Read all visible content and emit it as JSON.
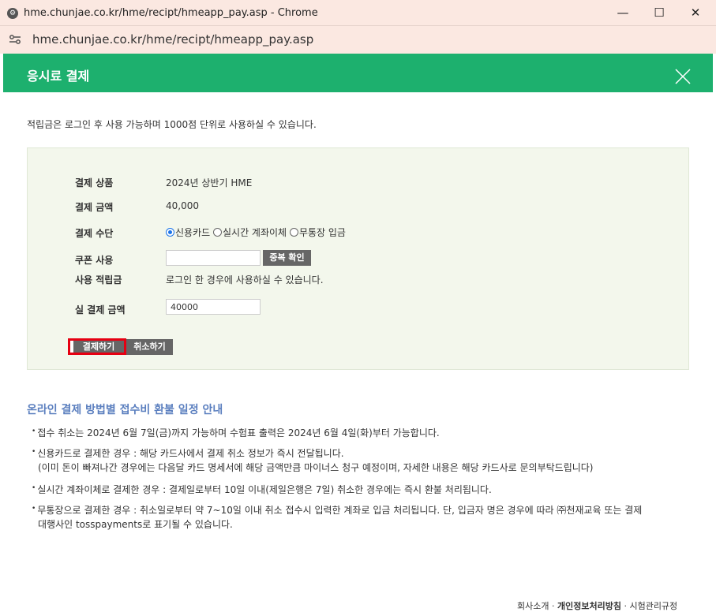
{
  "window": {
    "title": "hme.chunjae.co.kr/hme/recipt/hmeapp_pay.asp - Chrome",
    "url": "hme.chunjae.co.kr/hme/recipt/hmeapp_pay.asp",
    "minimize": "—",
    "maximize": "☐",
    "close": "✕"
  },
  "header": {
    "title": "응시료 결제"
  },
  "notice": "적립금은 로그인 후 사용 가능하며 1000점 단위로 사용하실 수 있습니다.",
  "form": {
    "product_label": "결제 상품",
    "product_value": "2024년 상반기 HME",
    "amount_label": "결제 금액",
    "amount_value": "40,000",
    "method_label": "결제 수단",
    "method_options": [
      "신용카드",
      "실시간 계좌이체",
      "무통장 입금"
    ],
    "method_selected": "신용카드",
    "coupon_label": "쿠폰 사용",
    "coupon_value": "",
    "coupon_check_button": "중복 확인",
    "points_label": "사용 적립금",
    "points_note": "로그인 한 경우에 사용하실 수 있습니다.",
    "final_label": "실 결제 금액",
    "final_value": "40000",
    "pay_button": "결제하기",
    "cancel_button": "취소하기"
  },
  "refund": {
    "title": "온라인 결제 방법별 접수비 환불 일정 안내",
    "items": [
      "접수 취소는 2024년 6월 7일(금)까지 가능하며 수험표 출력은 2024년 6월 4일(화)부터 가능합니다.",
      "신용카드로 결제한 경우 : 해당 카드사에서 결제 취소 정보가 즉시 전달됩니다.",
      "(이미 돈이 빠져나간 경우에는 다음달 카드 명세서에 해당 금액만큼 마이너스 청구 예정이며, 자세한 내용은 해당 카드사로 문의부탁드립니다)",
      "실시간 계좌이체로 결제한 경우 : 결제일로부터 10일 이내(제일은행은 7일) 취소한 경우에는 즉시 환불 처리됩니다.",
      "무통장으로 결제한 경우 : 취소일로부터 약 7~10일 이내 취소 접수시 입력한 계좌로 입금 처리됩니다. 단, 입금자 명은 경우에 따라 ㈜천재교육 또는 결제",
      "대행사인 tosspayments로 표기될 수 있습니다."
    ]
  },
  "footer": {
    "links": [
      "회사소개",
      "개인정보처리방침",
      "시험관리규정"
    ]
  },
  "colors": {
    "header_green": "#1db06e",
    "panel_bg": "#f3f7ec",
    "refund_title": "#5b7fbf",
    "highlight_red": "#e60012",
    "dark_button": "#666666"
  }
}
